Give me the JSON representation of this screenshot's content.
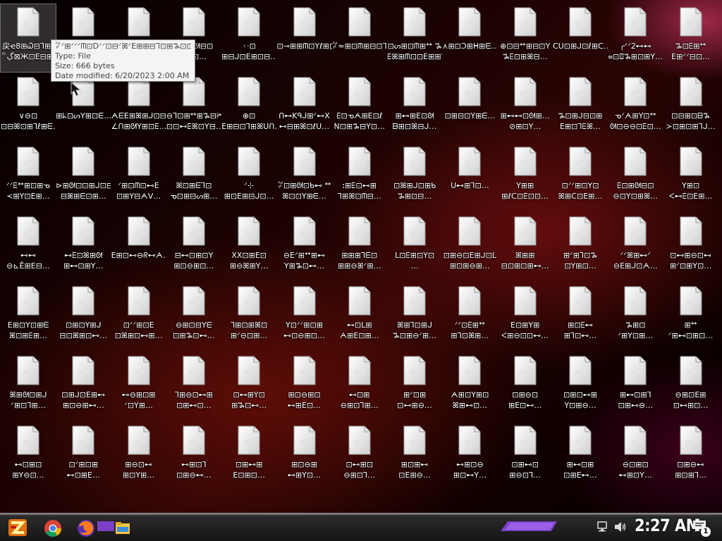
{
  "desktop": {
    "columns": 13,
    "icon_type": "generic-file-icon",
    "selected_index": 0,
    "icons": [
      "戻ҽ8⊞Ꮗ⊟ꓶ⊞ℓ\n꒪ڳ⊠Ж⊡ꓰ⊟⊞ᘛ…",
      "⊞ꇗ⊡⊞ᗰ⊡ᖾ\n⊟⊞⊡ꓬ…",
      "ℓ⊡⊞ᒍ⊡Ꮳ\n⊟ꕤ⊡⊞…",
      "ꇗ⊡⊞ᘛ⊟⊡\nꓰ⊞⊡…",
      "ᚲ⋅⊡\n⊞⊟ᒍ⊡ꓰ⊞⊡⊟…",
      "⊡⊸⊞⊞ᗰ⊡ꓬℓ⊞⊡⋏ᗴ⊟↞",
      "ꇗ≈⊞⊡ᗰ⊞⊟⊡ꓶ⊞ℓ⊡ᒍ…",
      "⊡ᔕ⊞⊡ᗰ⊞ᕯ ꖆ\nꗋꕤ⊞ᗰ⊡⊡ꓰ⊞⊞ꓶ…",
      "⋏⊞⊡ꓛ⊞ᕼ⊞ᗴ…",
      "⊕⊡⊟ᕯ⊞⊟⊡ꓬ\nꖆꗋ⊡⊞ꕤ⊟…",
      "ꓚꓴ⊡⊞ᒍ⊡ℓ⊞ᑕ…",
      "╭ᐟᐟ2⊷⊷\nⳬ⊡ꘖꖆ⊞⊡⊞ꓬ…",
      "ꖆ⊡ꗋ⊞ᕯ\nꓰ⊞ᐟᐟ⊟⊡…",
      "∨⊖⊡\n⊡⊟ꕤ⊡⊞ꓶℓ⊞ᗴ…",
      "⊞ᖾ⊡ᔕꓬ⊞⊡ᗴ…",
      "ᗅᗴꓰ⊞ꕤ⊞ᒍ⊡⊟\n∠ᑎ⊞ᘛꓬ⊞⊡ꗋ…",
      "⊖ꓶ⊡⊞ᕯ⊞ꖆ⊟ꔶ\n⊡⊡⊷ꗋꕤ⊡ꓬ⊟…",
      "⊕⊡\nꓰ⊞⊟⊡ꓶ⊞ꕤᑌᑎ…",
      "ᑎ⊷Kᑫᒍ⊞ᐟ⊷ꓫ\n⊷⊟⊞ꕤ⊡ℓᑌ…",
      "ꗋ⊡ᓀᗅ⊞ꓰ⊡ℓ\nꓠ⊡⊞ꖆ⊟ꓬ⊡…",
      "⊞⊷⊞ꓰ⊡ᘛ\nᗷ⊞⊡ꕤ⊟ᒍ…",
      "⊡⊞⊟⊡ꓬ⊞ᗴ…",
      "⊞⊷⊷⊡ᘛ⊞…\n⊘⊞⊡ꓬ…",
      "ꖆ⊡⊞ᒍ⊟⊡⊞\nꓰ⊞⊡ꓶꗋꕤ…",
      "ᓀᐟᗅ⊞ꓬ⊡ᕯ\nᘛ⊡⊖⊖⊡ꗋ⊡…",
      "⊡⊟⊞⊡ᗷꖆ\n≻⊡⊞⊡⊞ꓶᒍ…",
      "ᐟᐟꗋᕯ⊞⊡⊞ᓀ\n≺⊞ꓬ⊡ꓰ⊞…",
      "⊳⊞ᘛ⊡⊡⊞ᒍ⊡⊟\n⊟ꕤ⊞ᗴ⊡⊞…",
      "ᐟ⊞⊡ᗰ⊡⊷ꓰ\n⊡⊞ꓬ⊟ᗅᐯ…",
      "ꕤ⊡⊞ᗴꓶ⊡\nᓀ⊡⊞⊟ᔕ⊞…",
      "ᐟ⊹\n⊞⊡ꓰ⊞⊟ᒍ⊡…",
      "ꇗ⊡⊞ᘛ⊡ᑲ⊷ ᕯ\nꕤ⊡⊡ꓬ⊞ᗴ…",
      "ꓽ⊞ꗋ⊡⊷⊞\nꓶ⊞ꕤ⊡ᗰ⊟…",
      "⊡ꕤ⊞ᒍ⊡⊞ᑲ\nꖆ⊞⊡⊟…",
      "ᑌ⊷⊞ꓶ⊡…",
      "ꓬ⊞⊞\n⊞ℓᑕ⊡ꗋ⊡⊡…",
      "⊡ᐟᐟ⊞⊡ꓬ⊡\nꕤ⊞ᑕ⊡ꓰ⊞…",
      "ꗋ⊡⊞ᘛ⊟⊡\n⊖⊡ꓬ⊡⊞ꕤ…",
      "ꓬ⊞⊡\nᐸ⊷ꗋ⊡ꓰ⊞…",
      "⊷⊷\n⊖⊾Ê⊞ꓰ⊟…",
      "⊷ꗋ⊡ꕤ⊞ᘛ\n⊞⊷⊡⊞ꓬ…",
      "ꓰ⊞⊡⊷⊖ᖇ⊷ᗅ…",
      "⊟⊷⊡⊞⊡ꓬ\n⊞⊡⊖⊞⊡…",
      "ꓫꓫ⊡⊞ꓰ⊡\n⊞⊖ꕤ⊞ꓬ…",
      "⊖ꓰᐟ⊞ᕯ⊞⊷\nꓬ⊞ꖆ⊡⊷…",
      "⊞⊞⊞ꓶᗴ⊡\n⊞⊞⊖ꕤᐟ⊞…",
      "ᒪ⊡ꗋ⊞⊡ꓬ⊡\n…",
      "⊡⊞⊖⊡ꓰ⊞ᒍ⊡ᒪ\n⊞⊡⊞⊖⊞…",
      "ꕤ⊞⊞\n⊟⊡⊞⊡⊞⊷…",
      "⊞ᐟ⊞ꓶ⊡ꖆ\n⊡ꓬ⊞⊡…",
      "ᐟᐟꕤ⊞⊷ᐟ\n⊖ꓰ⊞ᒍ⊡ᗅ…",
      "⊡⊷⊞⊖⊡⊷\n⊞ᐟ⊡⊞ꓬ⊡…",
      "ꓰ⊞⊡ꓬ⊡⊞ᗴ\nꕤ⊡⊞ꗋ⊞…",
      "⊡⊞⊡ꓬ⊞ᒍ\n⊟⊡ꕤ⊞⊡⊷…",
      "⊡ᐟᐟ⊞⊡ꓰ\n⊡ꕤ⊞⊡⊷⊞…",
      "⊖⊞⊡⊟ꓬᗴ\n⊡⊞ꖆ⊡⊷…",
      "ꓶ⊞⊡⊞ꕤ⊡\n⊞ᐟ⊖⊡⊞…",
      "ꓬ⊡ᐟᐟ⊞⊡⊞\n⊷⊡⊖⊞⊡…",
      "⊷⊡ᒪ⊞\nᗅ⊞ꓰ⊡⊞…",
      "ꕤ⊞ꓶ⊡⊞ᒍ\nꖆ⊡⊞⊖ᐟ⊞…",
      "ᐟᐟ⊡ꗋ⊞ᕯ\n⊞ꓶ⊡ꕤ⊞…",
      "ꓰ⊡⊞ꓬ⊞\nᐸ⊞⊖⊡⊡⊷…",
      "⊞⊡ꗋ⊷\n⊞ꓶ⊡⊷…",
      "ꖆ⊞⊡\nᐟ⊞ꓬ⊡⊞…",
      "⊞ᕯ\nᐟ⊞⊷⊡⊞⊡…",
      "ꕤ⊞ᘛ⊡⊞ᒍ\nᐟ⊞⊡ꓶ⊞…",
      "⊡⊞ᒍ⊡ꓰ⊞⊷\n⊞⊡⊖⊞⊷…",
      "⊷⊖⊞⊡⊞\nᐟ⊡ꓬ⊞…",
      "ꓶ⊞⊖⊡⊷⊞\n⊡⊞⊷⊡…",
      "⊡⊷⊞ꓬ⊡\n⊞ꖆ⊡⊷…",
      "⊞⊡⊖⊞⊡\n⊷⊞ꓰ⊡…",
      "⊷⊡⊞\n⊖⊞⊡ꓶ⊞…",
      "⊞ᐟ⊡⊞\n⊡⊷⊞⊖…",
      "ᗅ⊞⊡ꓬ⊞⊡\nꕤ⊞⊷⊡…",
      "⊡⊞⊖⊡\n⊞ꓰ⊡⊷…",
      "⊡⊞⊡⊷⊞\nꓬ⊡⊞⊖…",
      "⊞⊷⊡⊞ꓶ\n⊡⊞⊷⊖…",
      "⊖⊞⊡ꓰ⊞\n⊡⊷⊞⊡…",
      "⊷⊡⊞⊡\n⊞ꓬ⊖⊡…",
      "⊡ᐟ⊞⊡⊞\n⊷⊡⊞ꓰ…",
      "⊞⊖⊡⊷\n⊞⊡ꓬ⊞…",
      "⊷⊞⊡ꓶ\n⊡⊞⊖⊷…",
      "⊡⊞⊷⊞\nꓰ⊡⊞⊡…",
      "⊞⊡⊖⊞\n⊷⊞ꓬ⊡…",
      "⊡⊷⊞⊡\n⊖⊞⊡ꓶ…",
      "⊞⊡⊞⊷\n⊡ꓰ⊞⊖…",
      "⊷⊞⊡⊖\n⊞⊡⊷ꓬ…",
      "⊡⊞⊷⊡\n⊞⊖⊡ꓶ…",
      "⊞⊷⊡⊞\n⊡⊞ꓰ⊷…",
      "⊖⊡⊞⊡\n⊷⊞⊡ꓬ…",
      "⊡⊞⊖⊷\n⊞⊡⊞ꓶ…"
    ]
  },
  "tooltip": {
    "name": "ꇗᐟ⊞ᐟᐟᐟᗰ⊡ꓓᐟᐟ⊡⊟ᐟꕤᐟꓰ⊞⊞⊟ꓶ⊡⊞ꖆ⊡⊡ᗅᐟ",
    "type": "Type: File",
    "size": "Size: 666 bytes",
    "modified": "Date modified: 6/20/2023 2:00 AM"
  },
  "taskbar": {
    "clock": "2:27 AM",
    "notification_count": "1",
    "pinned": [
      "start-button",
      "chrome-icon",
      "firefox-icon",
      "file-explorer-icon"
    ],
    "tray": [
      "network-icon",
      "volume-icon"
    ],
    "accent": "#7b3fc8"
  }
}
